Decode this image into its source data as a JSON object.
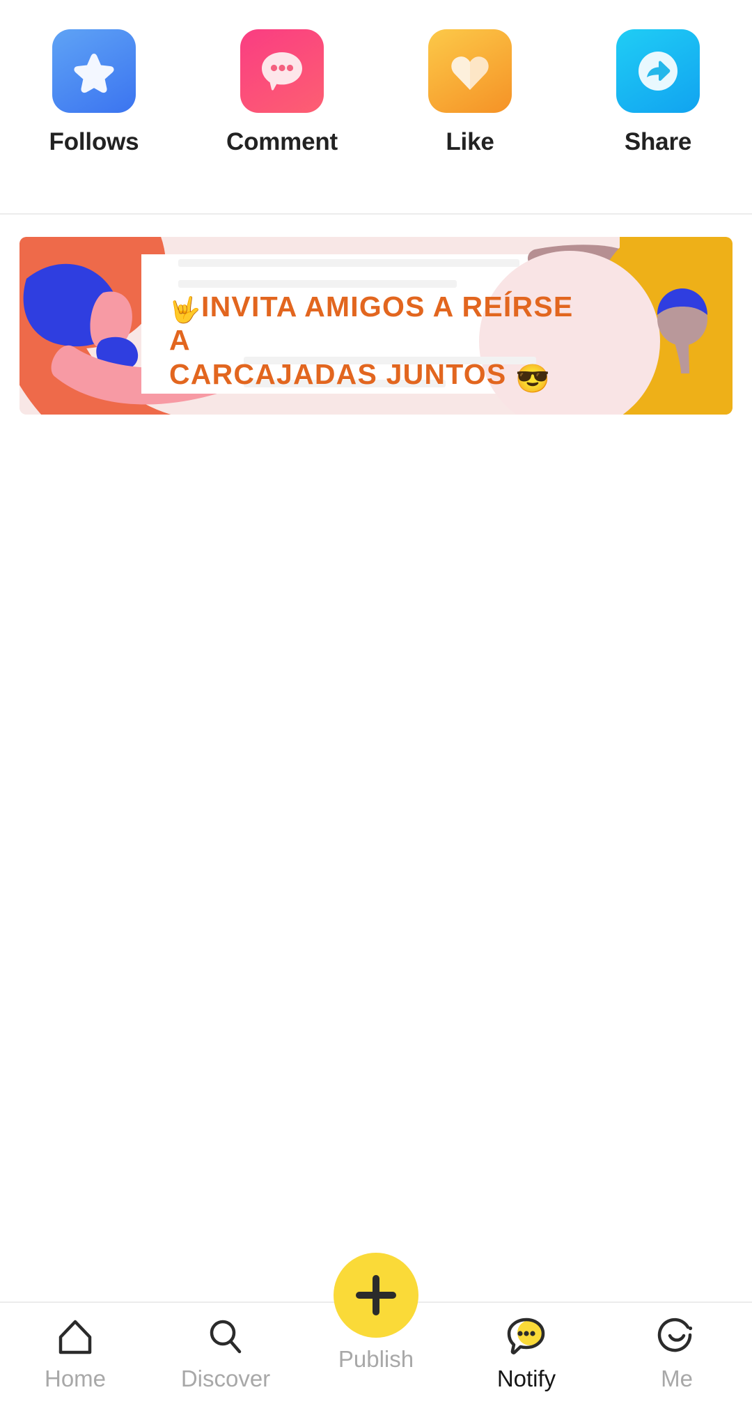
{
  "actions": [
    {
      "label": "Follows",
      "icon": "star-icon",
      "color": "#3b74f0"
    },
    {
      "label": "Comment",
      "icon": "speech-bubble-icon",
      "color": "#fa3d82"
    },
    {
      "label": "Like",
      "icon": "heart-icon",
      "color": "#f59226"
    },
    {
      "label": "Share",
      "icon": "share-arrow-icon",
      "color": "#11a3f0"
    }
  ],
  "banner": {
    "headline_line1": "INVITA AMIGOS A REÍRSE A",
    "headline_line2": "CARCAJADAS JUNTOS",
    "hand_emoji": "🤟",
    "cool_emoji": "😎",
    "text_color": "#e2661f",
    "bg_left_color": "#f8e7e6",
    "bg_right_color": "#eeb018",
    "accent_coral": "#ee6a4a",
    "accent_blue": "#2f3ee0",
    "accent_pink": "#f79aa4"
  },
  "bottom_nav": {
    "items": [
      {
        "label": "Home",
        "icon": "home-icon",
        "active": false
      },
      {
        "label": "Discover",
        "icon": "search-icon",
        "active": false
      },
      {
        "label": "Publish",
        "icon": "plus-icon",
        "active": false
      },
      {
        "label": "Notify",
        "icon": "notification-chat-icon",
        "active": true
      },
      {
        "label": "Me",
        "icon": "profile-smiley-icon",
        "active": false
      }
    ],
    "fab_color": "#fada38",
    "active_color": "#151515",
    "inactive_color": "#a8a8a8"
  }
}
